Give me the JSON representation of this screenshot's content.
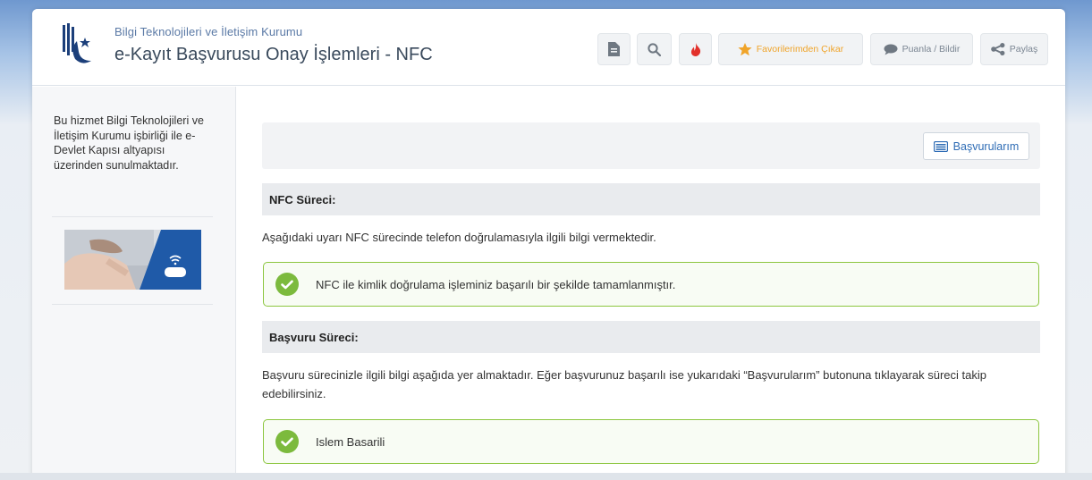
{
  "header": {
    "org_name": "Bilgi Teknolojileri ve İletişim Kurumu",
    "page_title": "e-Kayıt Başvurusu Onay İşlemleri - NFC"
  },
  "toolbar": {
    "favorite_label": "Favorilerimden Çıkar",
    "rate_label": "Puanla / Bildir",
    "share_label": "Paylaş"
  },
  "sidebar": {
    "info_text": "Bu hizmet Bilgi Teknolojileri ve İletişim Kurumu işbirliği ile e-Devlet Kapısı altyapısı üzerinden sunulmaktadır."
  },
  "main": {
    "applications_button": "Başvurularım",
    "nfc_section": {
      "title": "NFC Süreci:",
      "description": "Aşağıdaki uyarı NFC sürecinde telefon doğrulamasıyla ilgili bilgi vermektedir.",
      "success_message": "NFC ile kimlik doğrulama işleminiz başarılı bir şekilde tamamlanmıştır."
    },
    "application_section": {
      "title": "Başvuru Süreci:",
      "description": "Başvuru sürecinizle ilgili bilgi aşağıda yer almaktadır. Eğer başvurunuz başarılı ise yukarıdaki “Başvurularım” butonuna tıklayarak süreci takip edebilirsiniz.",
      "success_message": "Islem Basarili"
    }
  },
  "colors": {
    "success_border": "#8cc63f",
    "success_icon": "#7cba3d",
    "favorite_star": "#f0a42a",
    "fire_icon": "#e2312b",
    "link_blue": "#2e6cb5"
  }
}
